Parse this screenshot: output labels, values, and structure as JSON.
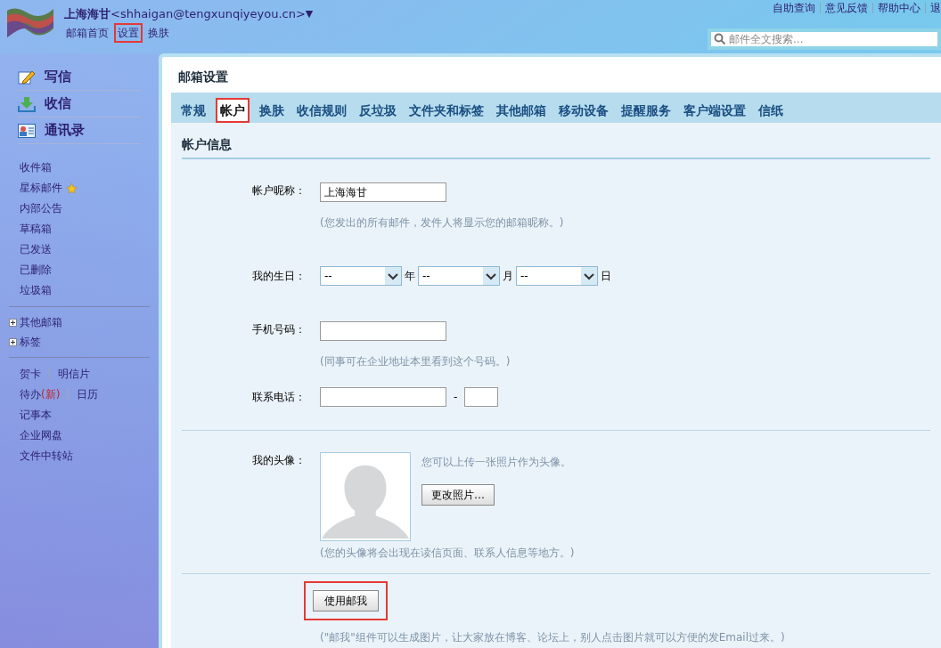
{
  "header": {
    "user": {
      "name": "上海海甘",
      "email": "<shhaigan@tengxunqiyeyou.cn>",
      "caret": "▼"
    },
    "nav_links": [
      {
        "label": "邮箱首页",
        "highlighted": false
      },
      {
        "label": "设置",
        "highlighted": true
      },
      {
        "label": "换肤",
        "highlighted": false
      }
    ],
    "top_links": [
      "自助查询",
      "意见反馈",
      "帮助中心",
      "退"
    ],
    "search": {
      "placeholder": "邮件全文搜索..."
    }
  },
  "sidebar": {
    "actions": [
      {
        "label": "写信",
        "kind": "compose"
      },
      {
        "label": "收信",
        "kind": "receive"
      },
      {
        "label": "通讯录",
        "kind": "contacts"
      }
    ],
    "folders": [
      {
        "label": "收件箱",
        "starred": false
      },
      {
        "label": "星标邮件",
        "starred": true
      },
      {
        "label": "内部公告",
        "starred": false
      },
      {
        "label": "草稿箱",
        "starred": false
      },
      {
        "label": "已发送",
        "starred": false
      },
      {
        "label": "已删除",
        "starred": false
      },
      {
        "label": "垃圾箱",
        "starred": false
      }
    ],
    "groups": [
      {
        "label": "其他邮箱",
        "expanded": false
      },
      {
        "label": "标签",
        "expanded": false
      }
    ],
    "tools": [
      {
        "items": [
          {
            "label": "贺卡"
          },
          {
            "label": "明信片"
          }
        ]
      },
      {
        "items": [
          {
            "label": "待办",
            "badge": "(新)"
          },
          {
            "label": "日历"
          }
        ]
      },
      {
        "items": [
          {
            "label": "记事本"
          }
        ]
      },
      {
        "items": [
          {
            "label": "企业网盘"
          }
        ]
      },
      {
        "items": [
          {
            "label": "文件中转站"
          }
        ]
      }
    ]
  },
  "panel": {
    "title": "邮箱设置",
    "tabs": [
      {
        "label": "常规",
        "selected": false,
        "highlighted": false
      },
      {
        "label": "帐户",
        "selected": true,
        "highlighted": true
      },
      {
        "label": "换肤",
        "selected": false,
        "highlighted": false
      },
      {
        "label": "收信规则",
        "selected": false,
        "highlighted": false
      },
      {
        "label": "反垃圾",
        "selected": false,
        "highlighted": false
      },
      {
        "label": "文件夹和标签",
        "selected": false,
        "highlighted": false
      },
      {
        "label": "其他邮箱",
        "selected": false,
        "highlighted": false
      },
      {
        "label": "移动设备",
        "selected": false,
        "highlighted": false
      },
      {
        "label": "提醒服务",
        "selected": false,
        "highlighted": false
      },
      {
        "label": "客户端设置",
        "selected": false,
        "highlighted": false
      },
      {
        "label": "信纸",
        "selected": false,
        "highlighted": false
      }
    ],
    "section_title": "帐户信息",
    "fields": [
      {
        "kind": "text",
        "label": "帐户昵称：",
        "value": "上海海甘",
        "hint": "(您发出的所有邮件，发件人将显示您的邮箱昵称。)"
      },
      {
        "kind": "date",
        "label": "我的生日：",
        "selects": [
          {
            "value": "--",
            "unit": "年"
          },
          {
            "value": "--",
            "unit": "月"
          },
          {
            "value": "--",
            "unit": "日"
          }
        ]
      },
      {
        "kind": "text",
        "label": "手机号码：",
        "hint": "(同事可在企业地址本里看到这个号码。)"
      },
      {
        "kind": "tel",
        "label": "联系电话：",
        "separator": "-"
      },
      {
        "kind": "avatar",
        "label": "我的头像：",
        "note": "您可以上传一张照片作为头像。",
        "button": "更改照片…",
        "hint": "(您的头像将会出现在读信页面、联系人信息等地方。)"
      },
      {
        "kind": "mailme",
        "button": "使用邮我",
        "highlighted": true,
        "hint": "(\"邮我\"组件可以生成图片，让大家放在博客、论坛上，别人点击图片就可以方便的发Email过来。)"
      }
    ]
  }
}
